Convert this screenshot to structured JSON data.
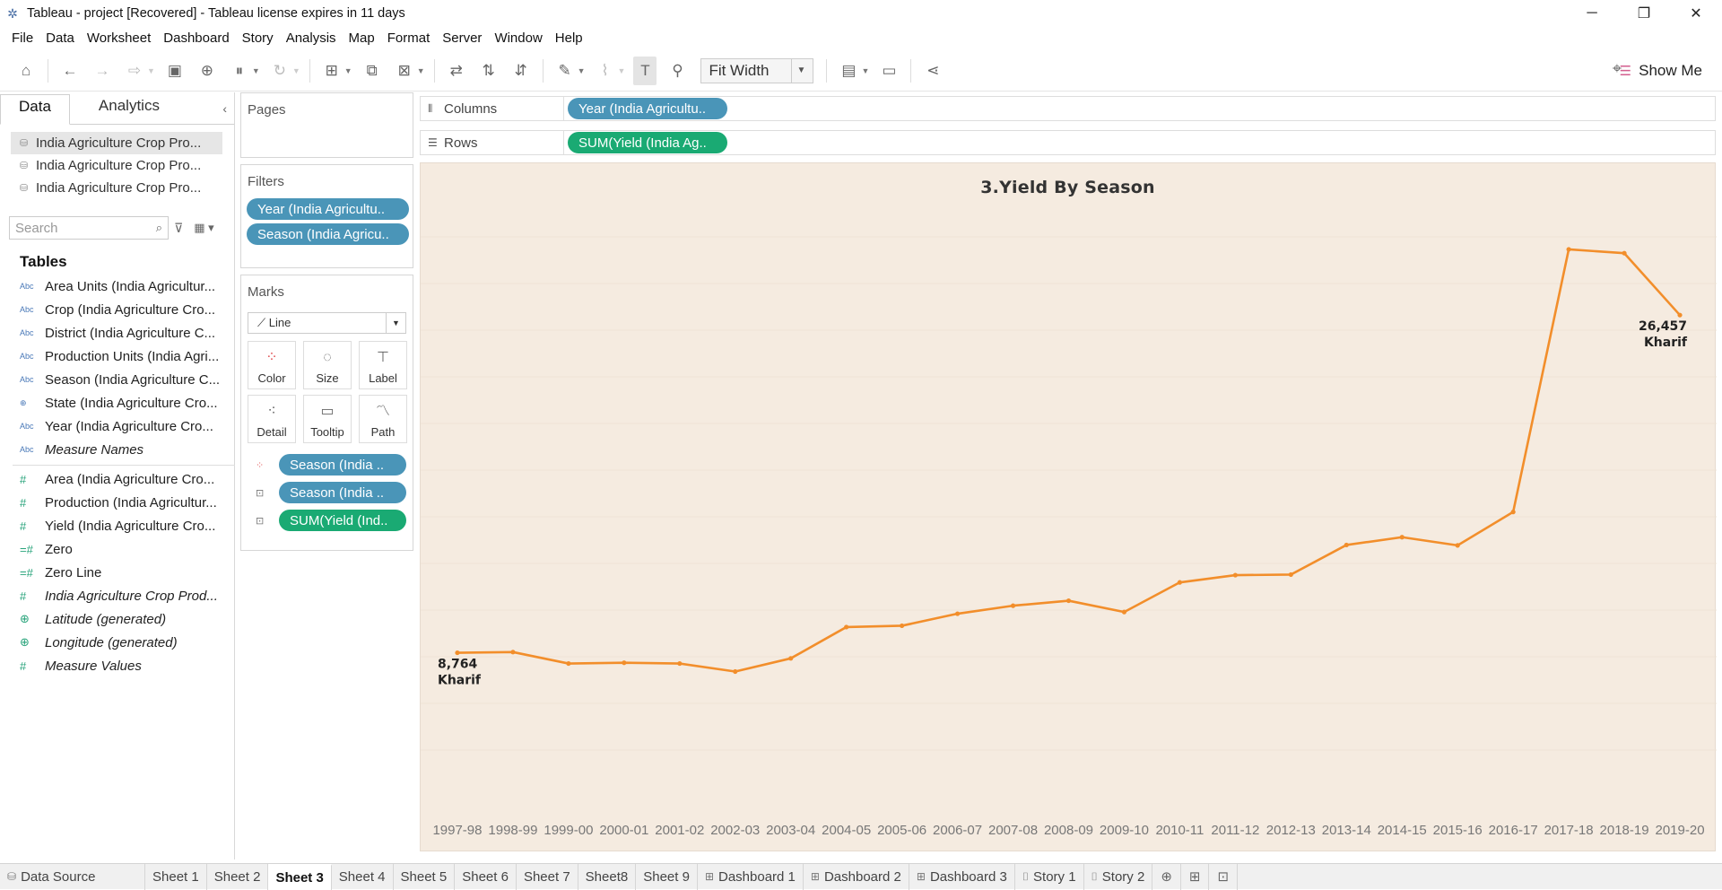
{
  "window": {
    "title": "Tableau - project [Recovered] - Tableau license expires in 11 days",
    "minimize": "─",
    "restore": "❐",
    "close": "✕"
  },
  "menu": [
    "File",
    "Data",
    "Worksheet",
    "Dashboard",
    "Story",
    "Analysis",
    "Map",
    "Format",
    "Server",
    "Window",
    "Help"
  ],
  "toolbar": {
    "fit_label": "Fit Width",
    "show_me_label": "Show Me"
  },
  "data_pane": {
    "tabs": [
      "Data",
      "Analytics"
    ],
    "data_sources": [
      "India Agriculture Crop Pro...",
      "India Agriculture Crop Pro...",
      "India Agriculture Crop Pro..."
    ],
    "search_placeholder": "Search",
    "tables_heading": "Tables",
    "dimensions": [
      {
        "type": "Abc",
        "name": "Area Units (India Agricultur..."
      },
      {
        "type": "Abc",
        "name": "Crop (India Agriculture Cro..."
      },
      {
        "type": "Abc",
        "name": "District (India Agriculture C..."
      },
      {
        "type": "Abc",
        "name": "Production Units (India Agri..."
      },
      {
        "type": "Abc",
        "name": "Season (India Agriculture C..."
      },
      {
        "type": "geo",
        "name": "State (India Agriculture Cro..."
      },
      {
        "type": "Abc",
        "name": "Year (India Agriculture Cro..."
      },
      {
        "type": "Abc",
        "name": "Measure Names",
        "italic": true
      }
    ],
    "measures": [
      {
        "type": "#",
        "name": "Area (India Agriculture Cro..."
      },
      {
        "type": "#",
        "name": "Production (India Agricultur..."
      },
      {
        "type": "#",
        "name": "Yield (India Agriculture Cro..."
      },
      {
        "type": "=#",
        "name": "Zero"
      },
      {
        "type": "=#",
        "name": "Zero Line"
      },
      {
        "type": "#",
        "name": "India Agriculture Crop Prod...",
        "italic": true
      },
      {
        "type": "geo",
        "name": "Latitude (generated)",
        "italic": true
      },
      {
        "type": "geo",
        "name": "Longitude (generated)",
        "italic": true
      },
      {
        "type": "#",
        "name": "Measure Values",
        "italic": true
      }
    ]
  },
  "pages_card": {
    "title": "Pages"
  },
  "filters_card": {
    "title": "Filters",
    "pills": [
      "Year (India Agricultu..",
      "Season (India Agricu.."
    ]
  },
  "marks_card": {
    "title": "Marks",
    "mark_type": "Line",
    "buttons": [
      "Color",
      "Size",
      "Label",
      "Detail",
      "Tooltip",
      "Path"
    ],
    "pills": [
      {
        "icon": "color",
        "label": "Season (India ..",
        "color": "#4a95b8"
      },
      {
        "icon": "label",
        "label": "Season (India ..",
        "color": "#4a95b8"
      },
      {
        "icon": "label",
        "label": "SUM(Yield (Ind..",
        "color": "#1aaa73"
      }
    ]
  },
  "shelves": {
    "columns_label": "Columns",
    "columns_pill": "Year (India Agricultu..",
    "rows_label": "Rows",
    "rows_pill": "SUM(Yield (India Ag.."
  },
  "viz": {
    "title": "3.Yield By Season",
    "start_label_value": "8,764",
    "start_label_season": "Kharif",
    "end_label_value": "26,457",
    "end_label_season": "Kharif",
    "line_color": "#f28e2b",
    "background": "#f5ebe0"
  },
  "chart_data": {
    "type": "line",
    "title": "3.Yield By Season",
    "categories": [
      "1997-98",
      "1998-99",
      "1999-00",
      "2000-01",
      "2001-02",
      "2002-03",
      "2003-04",
      "2004-05",
      "2005-06",
      "2006-07",
      "2007-08",
      "2008-09",
      "2009-10",
      "2010-11",
      "2011-12",
      "2012-13",
      "2013-14",
      "2014-15",
      "2015-16",
      "2016-17",
      "2017-18",
      "2018-19",
      "2019-20"
    ],
    "series": [
      {
        "name": "Kharif",
        "values": [
          8764,
          8800,
          8200,
          8240,
          8200,
          7780,
          8470,
          10110,
          10180,
          10810,
          11230,
          11490,
          10900,
          12450,
          12830,
          12860,
          14410,
          14820,
          14390,
          16140,
          29900,
          29700,
          26457
        ]
      }
    ],
    "xlabel": "",
    "ylabel": "",
    "ylim": [
      0,
      33000
    ],
    "grid": false
  },
  "bottom_tabs": {
    "data_source": "Data Source",
    "sheets": [
      "Sheet 1",
      "Sheet 2",
      "Sheet 3",
      "Sheet 4",
      "Sheet 5",
      "Sheet 6",
      "Sheet 7",
      "Sheet8",
      "Sheet 9"
    ],
    "active": "Sheet 3",
    "dashboards": [
      "Dashboard 1",
      "Dashboard 2",
      "Dashboard 3"
    ],
    "stories": [
      "Story 1",
      "Story 2"
    ]
  }
}
